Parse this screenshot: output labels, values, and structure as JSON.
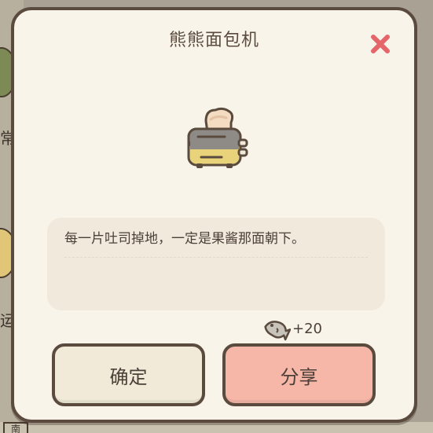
{
  "dialog": {
    "title": "熊熊面包机",
    "description": "每一片吐司掉地，一定是果酱那面朝下。",
    "reward": {
      "icon": "fish-icon",
      "amount": "+20"
    },
    "buttons": {
      "confirm_label": "确定",
      "share_label": "分享"
    },
    "item_icon": "toaster-icon",
    "close_icon": "close-icon"
  },
  "background": {
    "side_text_1": "常",
    "side_text_2": "运",
    "bottom_box_text": "南"
  },
  "colors": {
    "dialog_bg": "#f8f4ea",
    "border": "#5a4b3e",
    "confirm_bg": "#f1ead8",
    "share_bg": "#f6b7a8",
    "close": "#e4666a",
    "text": "#4d4038"
  }
}
